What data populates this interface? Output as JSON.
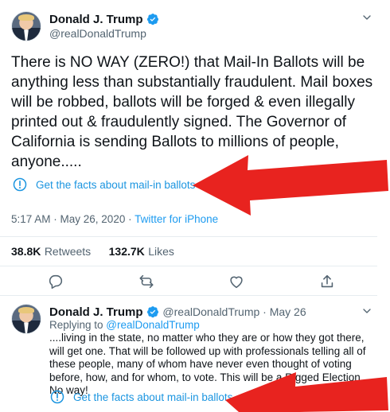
{
  "main_tweet": {
    "author_name": "Donald J. Trump",
    "author_handle": "@realDonaldTrump",
    "text": "There is NO WAY (ZERO!) that Mail-In Ballots will be anything less than substantially fraudulent. Mail boxes will be robbed, ballots will be forged & even illegally printed out & fraudulently signed. The Governor of California is sending Ballots to millions of people, anyone.....",
    "facts_label": "Get the facts about mail-in ballots",
    "timestamp": "5:17 AM · May 26, 2020 · ",
    "source": "Twitter for iPhone",
    "retweets_count": "38.8K",
    "retweets_label": "Retweets",
    "likes_count": "132.7K",
    "likes_label": "Likes"
  },
  "reply_tweet": {
    "author_name": "Donald J. Trump",
    "author_meta": "@realDonaldTrump · May 26",
    "replying_prefix": "Replying to ",
    "replying_handle": "@realDonaldTrump",
    "text": "....living in the state, no matter who they are or how they got there, will get one. That will be followed up with professionals telling all of these people, many of whom have never even thought of voting before, how, and for whom, to vote. This will be a Rigged Election. No way!",
    "facts_label": "Get the facts about mail-in ballots"
  },
  "colors": {
    "link_blue": "#1b95e0",
    "annotation_arrow_red": "#e8231f",
    "verified_blue": "#1d9bf0"
  },
  "icons": [
    "verified-badge-icon",
    "chevron-down-icon",
    "info-icon",
    "reply-icon",
    "retweet-icon",
    "like-icon",
    "share-icon"
  ]
}
